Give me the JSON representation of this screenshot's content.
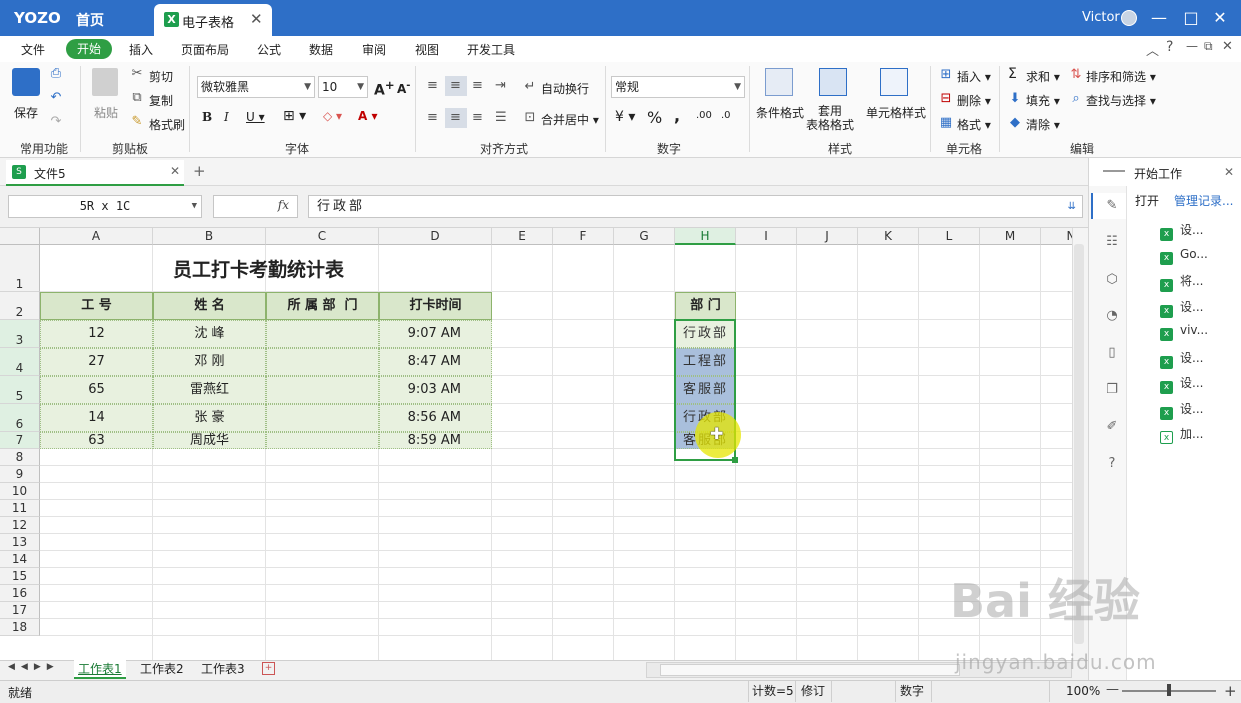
{
  "titlebar": {
    "brand": "YOZO",
    "home": "首页",
    "doc_tab": "电子表格",
    "user": "Victor",
    "window_buttons": [
      "—",
      "□",
      "✕"
    ]
  },
  "menu": [
    "文件",
    "开始",
    "插入",
    "页面布局",
    "公式",
    "数据",
    "审阅",
    "视图",
    "开发工具"
  ],
  "ribbon": {
    "groups": [
      "常用功能",
      "剪贴板",
      "字体",
      "对齐方式",
      "数字",
      "样式",
      "单元格",
      "编辑"
    ],
    "save": "保存",
    "paste": "粘贴",
    "cut": "剪切",
    "copy": "复制",
    "format_painter": "格式刷",
    "font_name": "微软雅黑",
    "font_size": "10",
    "wrap": "自动换行",
    "merge": "合并居中",
    "number_format": "常规",
    "cond_format": "条件格式",
    "table_format": "套用\n表格格式",
    "cell_style": "单元格样式",
    "insert": "插入",
    "delete": "删除",
    "format": "格式",
    "sum": "求和",
    "fill": "填充",
    "clear": "清除",
    "sort_filter": "排序和筛选",
    "find_select": "查找与选择"
  },
  "doc": {
    "tab": "文件5"
  },
  "formula_bar": {
    "name_box": "5R x 1C",
    "fx": "fx",
    "content": "行政部"
  },
  "grid": {
    "columns": [
      "A",
      "B",
      "C",
      "D",
      "E",
      "F",
      "G",
      "H",
      "I",
      "J",
      "K",
      "L",
      "M",
      "N"
    ],
    "rows": [
      "1",
      "2",
      "3",
      "4",
      "5",
      "6",
      "7",
      "8",
      "9",
      "10",
      "11",
      "12",
      "13",
      "14",
      "15",
      "16",
      "17",
      "18"
    ],
    "title": "员工打卡考勤统计表",
    "headers": [
      "工 号",
      "姓 名",
      "所 属 部  门",
      "打卡时间"
    ],
    "records": [
      [
        "12",
        "沈 峰",
        "",
        "9:07 AM"
      ],
      [
        "27",
        "邓 刚",
        "",
        "8:47 AM"
      ],
      [
        "65",
        "雷燕红",
        "",
        "9:03 AM"
      ],
      [
        "14",
        "张 豪",
        "",
        "8:56 AM"
      ],
      [
        "63",
        "周成华",
        "",
        "8:59 AM"
      ]
    ],
    "dept_header": "部 门",
    "depts": [
      "行政部",
      "工程部",
      "客服部",
      "行政部",
      "客服部"
    ]
  },
  "sheets": [
    "工作表1",
    "工作表2",
    "工作表3"
  ],
  "status": {
    "ready": "就绪",
    "count": "计数=5",
    "revise": "修订",
    "mode": "数字",
    "zoom": "100%"
  },
  "side_panel": {
    "title": "开始工作",
    "open": "打开",
    "manage": "管理记录...",
    "recent": [
      "设...",
      "Go...",
      "将...",
      "设...",
      "viv...",
      "设...",
      "设...",
      "设...",
      "加..."
    ]
  },
  "watermark": {
    "brand": "Bai 经验",
    "url": "jingyan.baidu.com"
  }
}
